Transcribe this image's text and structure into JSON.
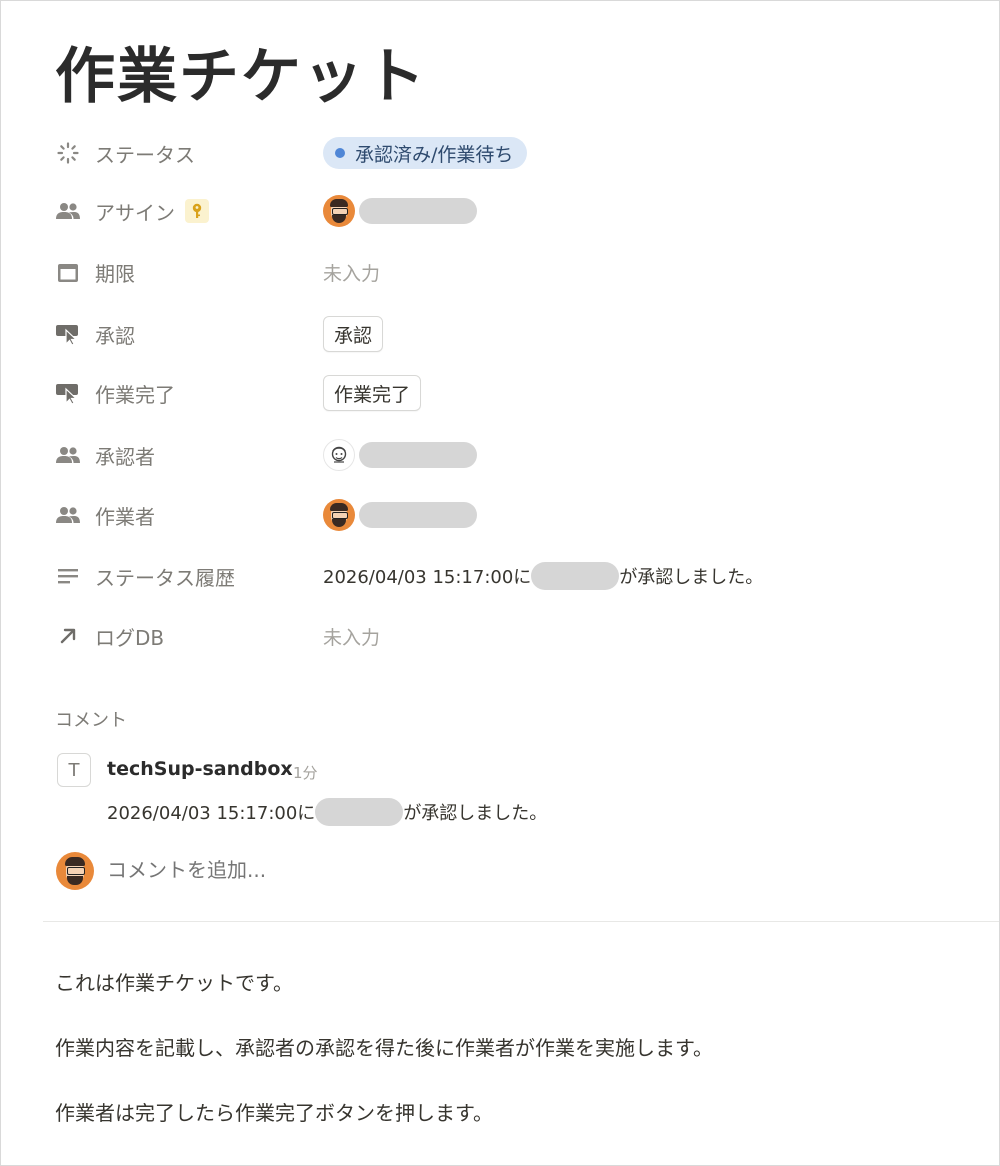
{
  "page": {
    "title": "作業チケット"
  },
  "properties": {
    "status": {
      "label": "ステータス",
      "value": "承認済み/作業待ち",
      "dot_color": "#4f86d6",
      "pill_color": "#dbe7f6",
      "icon": "status-spinner-icon"
    },
    "assign": {
      "label": "アサイン",
      "icon": "people-icon",
      "badge_icon": "key-icon"
    },
    "due": {
      "label": "期限",
      "value": "未入力",
      "icon": "calendar-icon"
    },
    "approve": {
      "label": "承認",
      "button": "承認",
      "icon": "cursor-click-icon"
    },
    "work_done": {
      "label": "作業完了",
      "button": "作業完了",
      "icon": "cursor-click-icon"
    },
    "approver": {
      "label": "承認者",
      "icon": "people-icon"
    },
    "worker": {
      "label": "作業者",
      "icon": "people-icon"
    },
    "status_history": {
      "label": "ステータス履歴",
      "value_prefix": "2026/04/03 15:17:00に",
      "value_suffix": "が承認しました。",
      "icon": "text-lines-icon"
    },
    "log_db": {
      "label": "ログDB",
      "value": "未入力",
      "icon": "arrow-up-right-icon"
    }
  },
  "comments": {
    "section_label": "コメント",
    "items": [
      {
        "author_initial": "T",
        "author": "techSup-sandbox",
        "time": "1分",
        "text_prefix": "2026/04/03 15:17:00に",
        "text_suffix": "が承認しました。"
      }
    ],
    "add_placeholder": "コメントを追加..."
  },
  "body": {
    "paragraphs": [
      "これは作業チケットです。",
      "作業内容を記載し、承認者の承認を得た後に作業者が作業を実施します。",
      "作業者は完了したら作業完了ボタンを押します。"
    ]
  },
  "colors": {
    "accent_blue": "#4f86d6",
    "muted_text": "#7d7b76",
    "placeholder_text": "#a5a39e",
    "redaction": "#d6d6d6"
  }
}
